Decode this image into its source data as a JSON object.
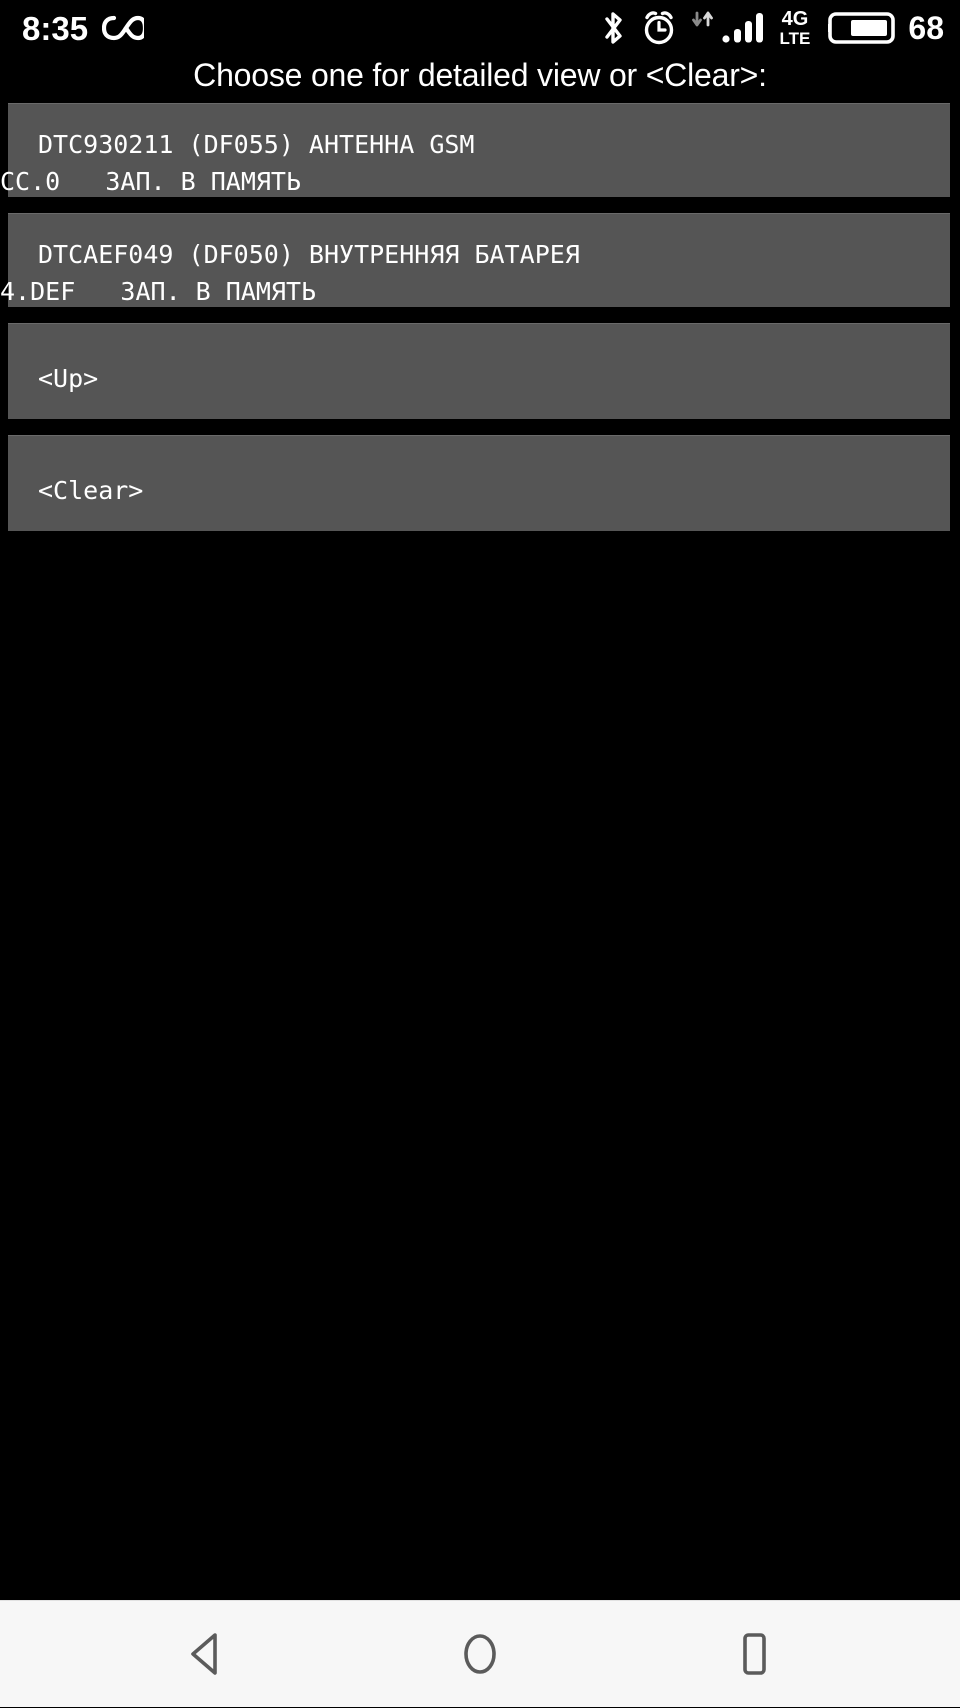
{
  "status_bar": {
    "clock": "8:35",
    "battery_percent": "68",
    "network_label_top": "4G",
    "network_label_bottom": "LTE",
    "icons": [
      "infinity-icon",
      "bluetooth-icon",
      "alarm-clock-icon",
      "data-transfer-icon",
      "signal-bars-icon",
      "network-4g-lte-icon",
      "battery-icon"
    ],
    "colors": {
      "background": "#000000",
      "foreground": "#ffffff",
      "muted": "#8a8a8a"
    }
  },
  "screen": {
    "title": "Choose one for detailed view or <Clear>:",
    "background": "#000000",
    "item_background": "#555555",
    "text_color": "#ffffff"
  },
  "list": {
    "items": [
      {
        "type": "dtc",
        "line1": "DTC930211 (DF055) АНТЕННА GSM",
        "line2": "CC.0   ЗАП. В ПАМЯТЬ"
      },
      {
        "type": "dtc",
        "line1": "DTCAEF049 (DF050) ВНУТРЕННЯЯ БАТАРЕЯ",
        "line2": "4.DEF   ЗАП. В ПАМЯТЬ"
      }
    ],
    "actions": [
      {
        "type": "action",
        "label": "<Up>"
      },
      {
        "type": "action",
        "label": "<Clear>"
      }
    ]
  },
  "nav_bar": {
    "background": "#f7f7f7",
    "icon_color": "#5b5b5b",
    "buttons": [
      {
        "name": "back",
        "icon": "back-triangle-icon"
      },
      {
        "name": "home",
        "icon": "home-circle-icon"
      },
      {
        "name": "recents",
        "icon": "recents-square-icon"
      }
    ]
  }
}
